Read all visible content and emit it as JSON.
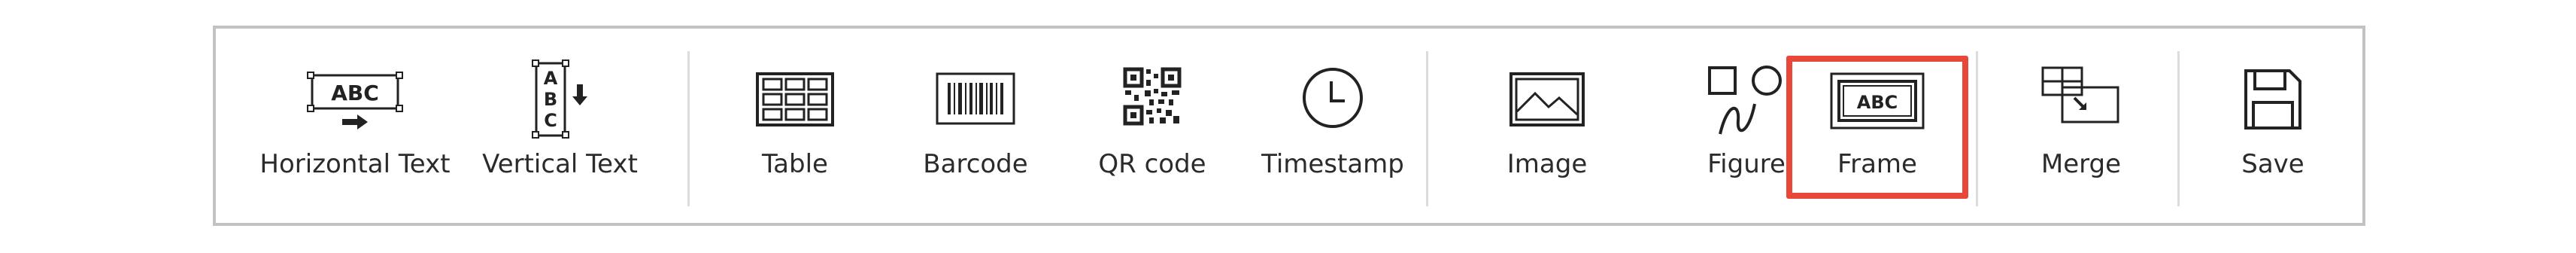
{
  "toolbar": {
    "items": [
      {
        "label": "Horizontal Text",
        "icon": "horizontal-text-icon"
      },
      {
        "label": "Vertical Text",
        "icon": "vertical-text-icon"
      },
      {
        "label": "Table",
        "icon": "table-icon"
      },
      {
        "label": "Barcode",
        "icon": "barcode-icon"
      },
      {
        "label": "QR code",
        "icon": "qr-code-icon"
      },
      {
        "label": "Timestamp",
        "icon": "clock-icon"
      },
      {
        "label": "Image",
        "icon": "image-icon"
      },
      {
        "label": "Figure",
        "icon": "figure-shapes-icon"
      },
      {
        "label": "Frame",
        "icon": "frame-icon",
        "selected": true
      },
      {
        "label": "Merge",
        "icon": "merge-cells-icon"
      },
      {
        "label": "Save",
        "icon": "floppy-disk-icon"
      }
    ],
    "icon_text": {
      "horizontal": "ABC",
      "vertical_letters": [
        "A",
        "B",
        "C"
      ],
      "frame": "ABC"
    },
    "colors": {
      "highlight": "#e8483a",
      "border": "#c2c2c2",
      "icon": "#222222"
    }
  }
}
